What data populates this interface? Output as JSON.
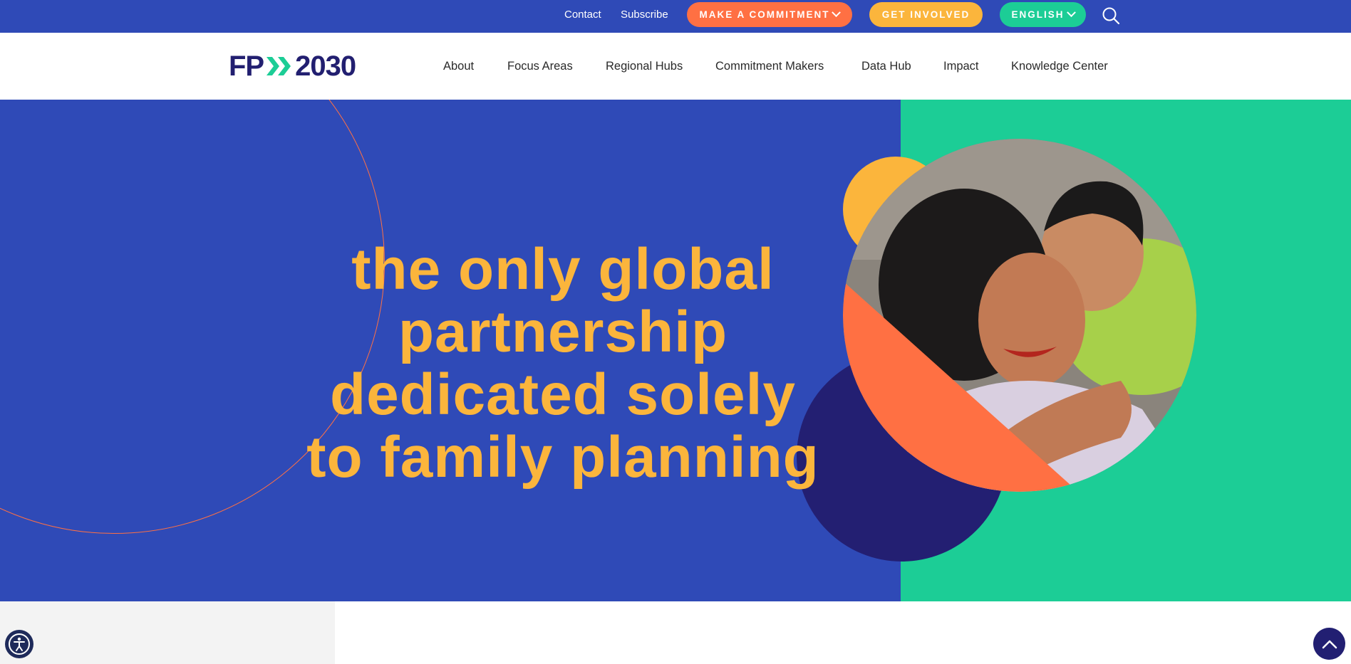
{
  "topbar": {
    "contact": "Contact",
    "subscribe": "Subscribe",
    "make_commitment": "MAKE A COMMITMENT",
    "get_involved": "GET INVOLVED",
    "language": "ENGLISH"
  },
  "logo": {
    "left": "FP",
    "right": "2030"
  },
  "nav": {
    "items": [
      {
        "label": "About"
      },
      {
        "label": "Focus Areas"
      },
      {
        "label": "Regional Hubs"
      },
      {
        "label": "Commitment Makers"
      },
      {
        "label": "Data Hub"
      },
      {
        "label": "Impact"
      },
      {
        "label": "Knowledge Center"
      }
    ]
  },
  "hero": {
    "headline_lines": [
      "the only global",
      "partnership",
      "dedicated solely",
      "to family planning"
    ]
  },
  "colors": {
    "brand_blue": "#2f4ab7",
    "brand_green": "#1ccd96",
    "brand_yellow": "#fbb53c",
    "brand_orange": "#ff7043",
    "brand_navy": "#231f72"
  },
  "icons": {
    "search": "search-icon",
    "language_dropdown": "chevron-down-icon",
    "accessibility": "accessibility-icon",
    "scroll_top": "chevron-up-icon"
  }
}
